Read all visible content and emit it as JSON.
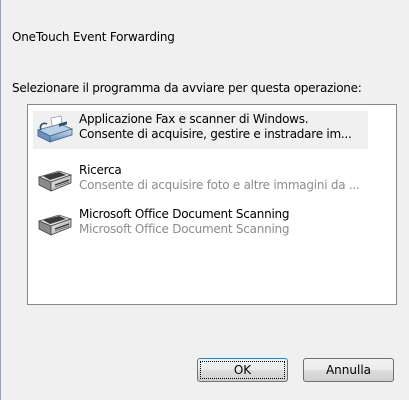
{
  "dialog": {
    "title": "OneTouch Event Forwarding",
    "prompt": "Selezionare il programma da avviare per questa operazione:"
  },
  "programs": [
    {
      "name": "Applicazione Fax e scanner di Windows.",
      "description": "Consente di acquisire, gestire e instradare im...",
      "icon": "fax-scanner-icon",
      "selected": true
    },
    {
      "name": "Ricerca",
      "description": "Consente di acquisire foto e altre immagini da ...",
      "icon": "scanner-icon",
      "selected": false
    },
    {
      "name": "Microsoft Office Document Scanning",
      "description": "Microsoft Office Document Scanning",
      "icon": "scanner-icon",
      "selected": false
    }
  ],
  "buttons": {
    "ok": "OK",
    "cancel": "Annulla"
  }
}
